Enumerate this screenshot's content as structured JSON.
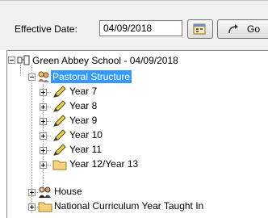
{
  "toolbar": {
    "effective_label": "Effective Date:",
    "date_value": "04/09/2018",
    "go_label": "Go"
  },
  "tree": {
    "root": "Green Abbey School - 04/09/2018",
    "pastoral": "Pastoral Structure",
    "years": [
      "Year  7",
      "Year  8",
      "Year  9",
      "Year 10",
      "Year 11"
    ],
    "year12_13": "Year 12/Year 13",
    "house": "House",
    "ncy": "National Curriculum Year Taught In"
  },
  "colors": {
    "selection": "#3399ff",
    "toolbar_bg": "#f0f0f0",
    "folder": "#f3d27a"
  }
}
